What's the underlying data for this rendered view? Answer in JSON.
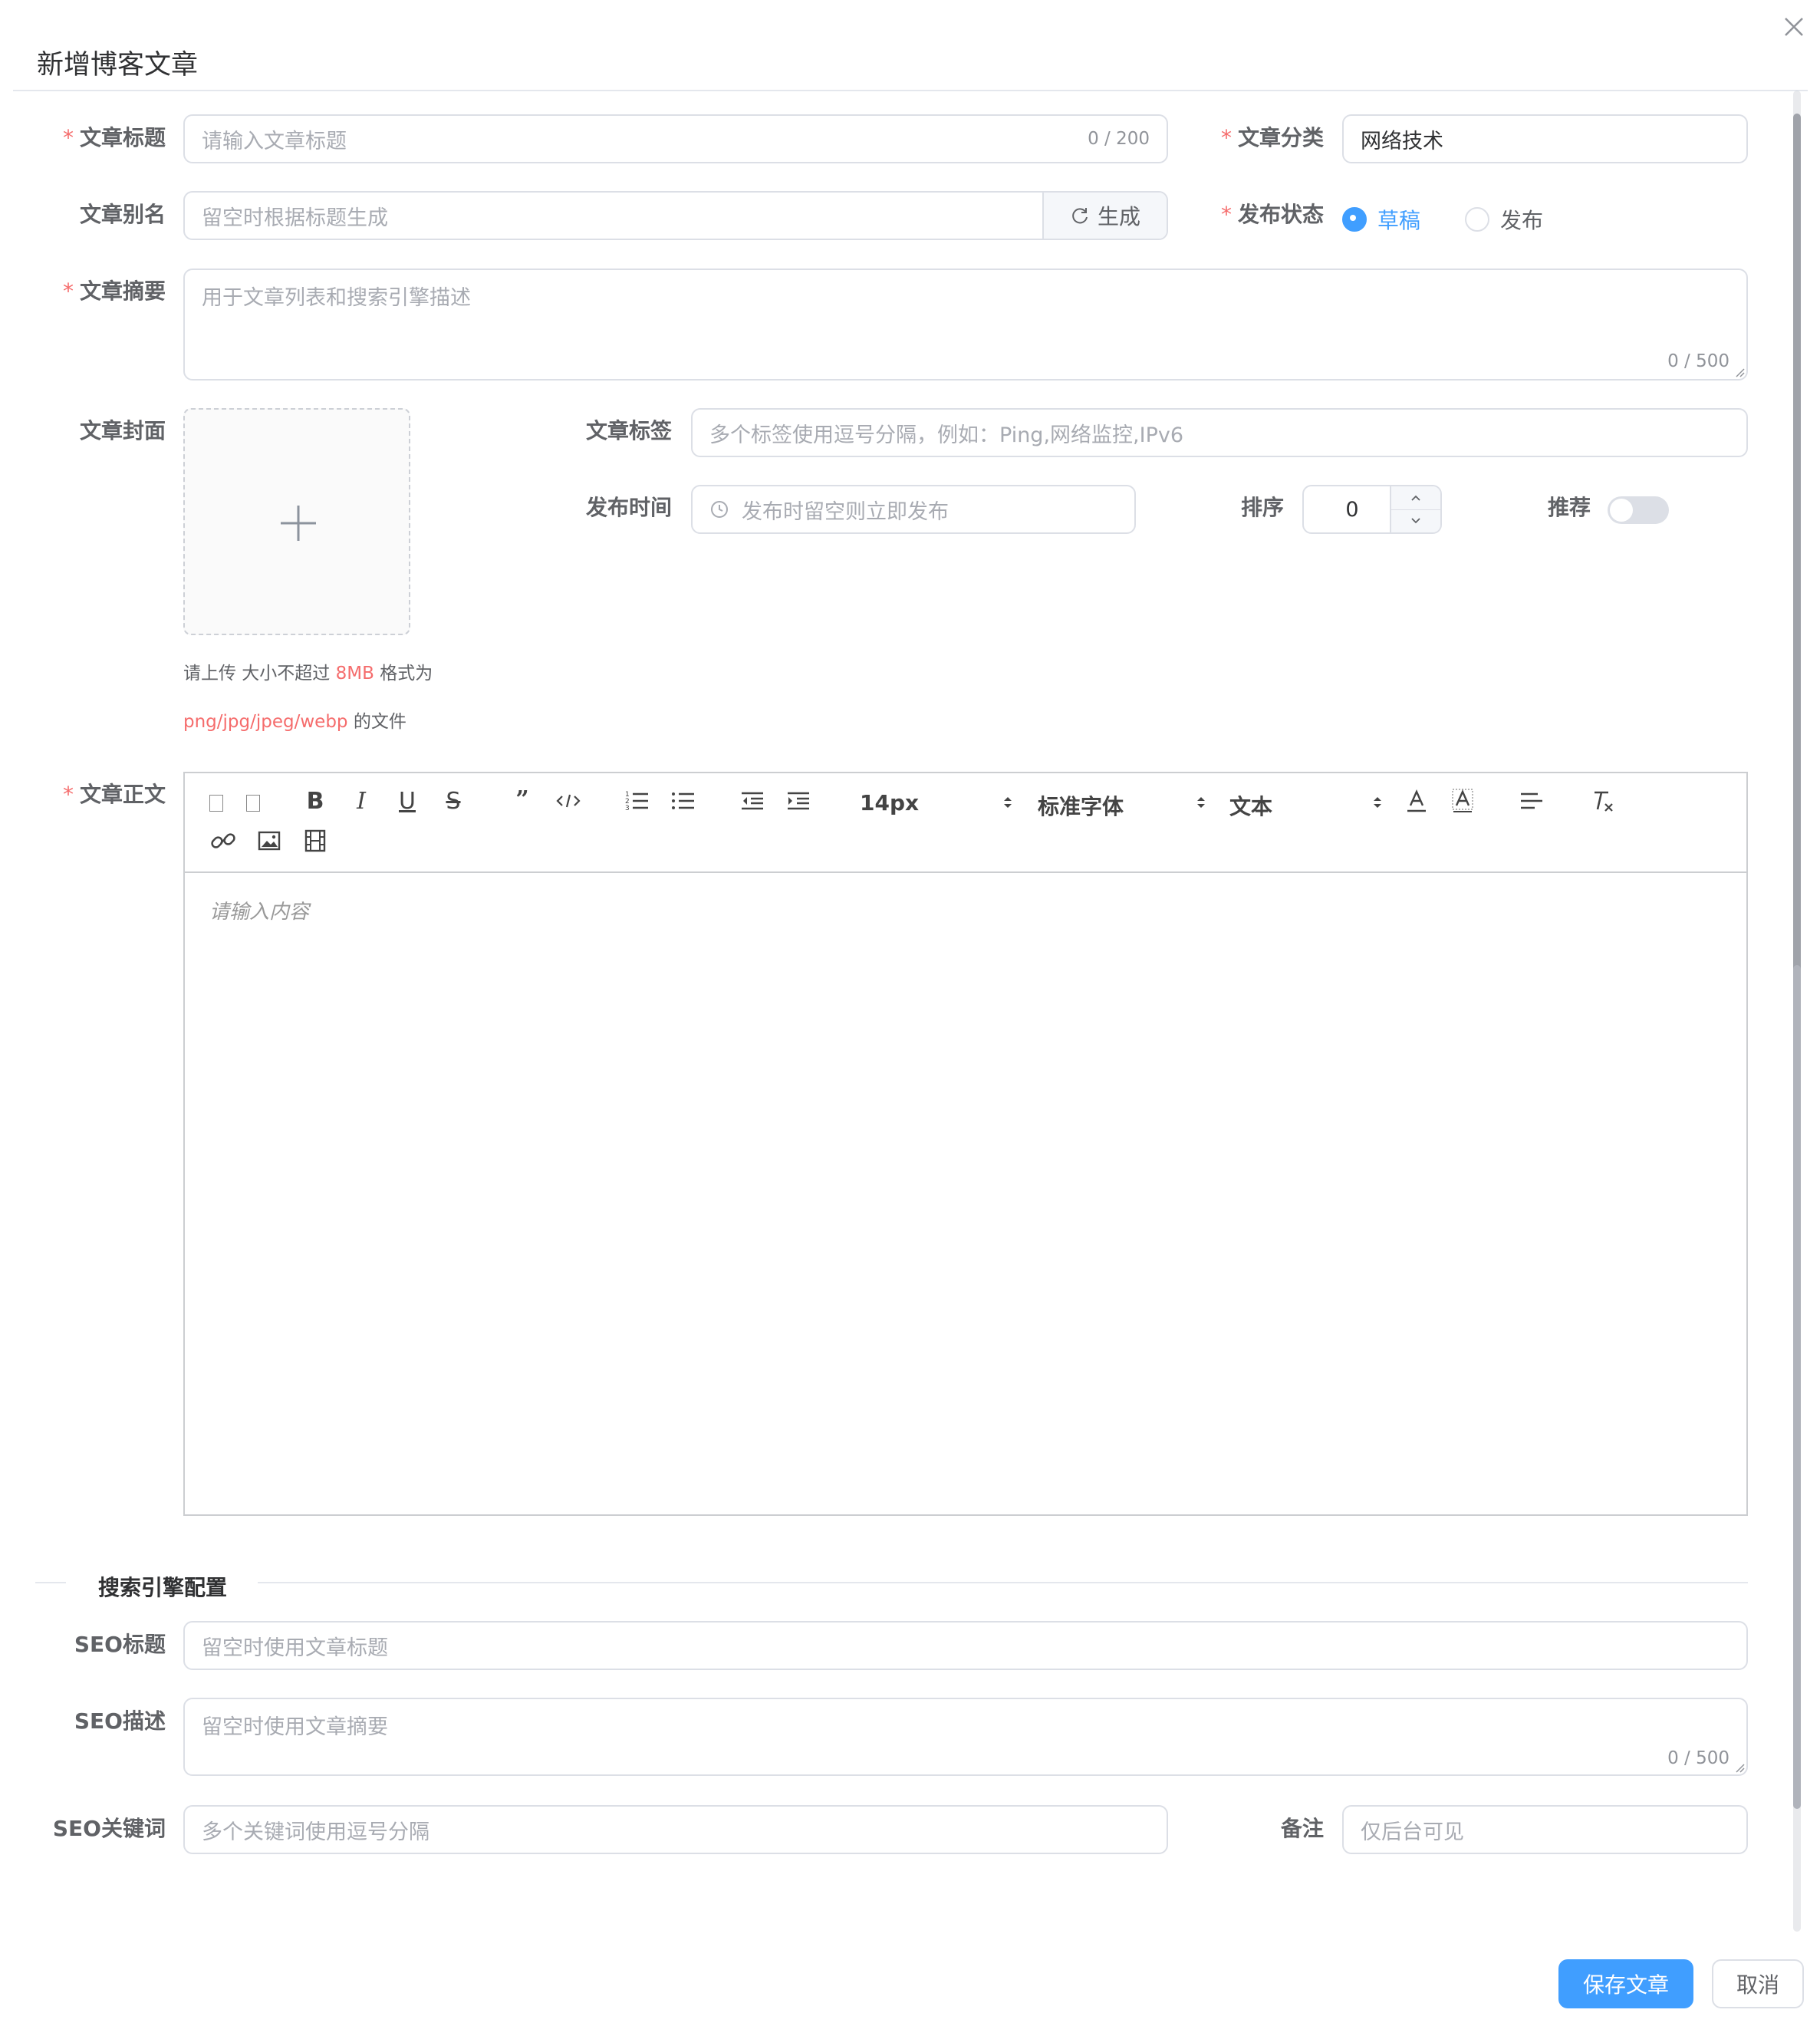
{
  "dialog": {
    "title": "新增博客文章"
  },
  "form": {
    "title": {
      "label": "文章标题",
      "placeholder": "请输入文章标题",
      "count": "0 / 200"
    },
    "category": {
      "label": "文章分类",
      "value": "网络技术"
    },
    "alias": {
      "label": "文章别名",
      "placeholder": "留空时根据标题生成",
      "button": "生成"
    },
    "status": {
      "label": "发布状态",
      "options": [
        "草稿",
        "发布"
      ],
      "selected": "草稿"
    },
    "summary": {
      "label": "文章摘要",
      "placeholder": "用于文章列表和搜索引擎描述",
      "count": "0 / 500"
    },
    "cover": {
      "label": "文章封面",
      "hint_prefix": "请上传 大小不超过 ",
      "hint_size": "8MB",
      "hint_mid": " 格式为",
      "hint_formats": "png/jpg/jpeg/webp",
      "hint_suffix": " 的文件"
    },
    "tags": {
      "label": "文章标签",
      "placeholder": "多个标签使用逗号分隔，例如：Ping,网络监控,IPv6"
    },
    "publish_time": {
      "label": "发布时间",
      "placeholder": "发布时留空则立即发布"
    },
    "sort": {
      "label": "排序",
      "value": "0"
    },
    "recommend": {
      "label": "推荐",
      "on": false
    },
    "content": {
      "label": "文章正文",
      "placeholder": "请输入内容",
      "font_size": "14px",
      "font_family": "标准字体",
      "block_type": "文本"
    }
  },
  "seo": {
    "section_title": "搜索引擎配置",
    "title": {
      "label": "SEO标题",
      "placeholder": "留空时使用文章标题"
    },
    "description": {
      "label": "SEO描述",
      "placeholder": "留空时使用文章摘要",
      "count": "0 / 500"
    },
    "keywords": {
      "label": "SEO关键词",
      "placeholder": "多个关键词使用逗号分隔"
    },
    "remark": {
      "label": "备注",
      "placeholder": "仅后台可见"
    }
  },
  "footer": {
    "save": "保存文章",
    "cancel": "取消"
  },
  "colors": {
    "primary": "#409eff",
    "danger": "#f56c6c",
    "border": "#dcdfe6",
    "placeholder": "#a8abb2"
  }
}
